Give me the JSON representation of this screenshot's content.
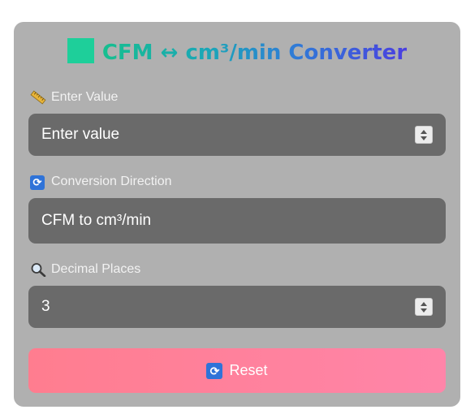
{
  "title": {
    "text": "CFM ↔ cm³/min Converter",
    "square_color": "#1ecf9a"
  },
  "fields": {
    "value": {
      "label": "Enter Value",
      "icon": "ruler-icon",
      "placeholder": "Enter value"
    },
    "direction": {
      "label": "Conversion Direction",
      "icon": "refresh-icon",
      "selected": "CFM to cm³/min"
    },
    "decimals": {
      "label": "Decimal Places",
      "icon": "magnifier-icon",
      "value": "3"
    }
  },
  "reset": {
    "label": "Reset",
    "icon": "refresh-icon"
  },
  "colors": {
    "card": "#b0b0b0",
    "field": "#6a6a6a",
    "reset_start": "#ff7d8f",
    "reset_end": "#ff85a9"
  }
}
